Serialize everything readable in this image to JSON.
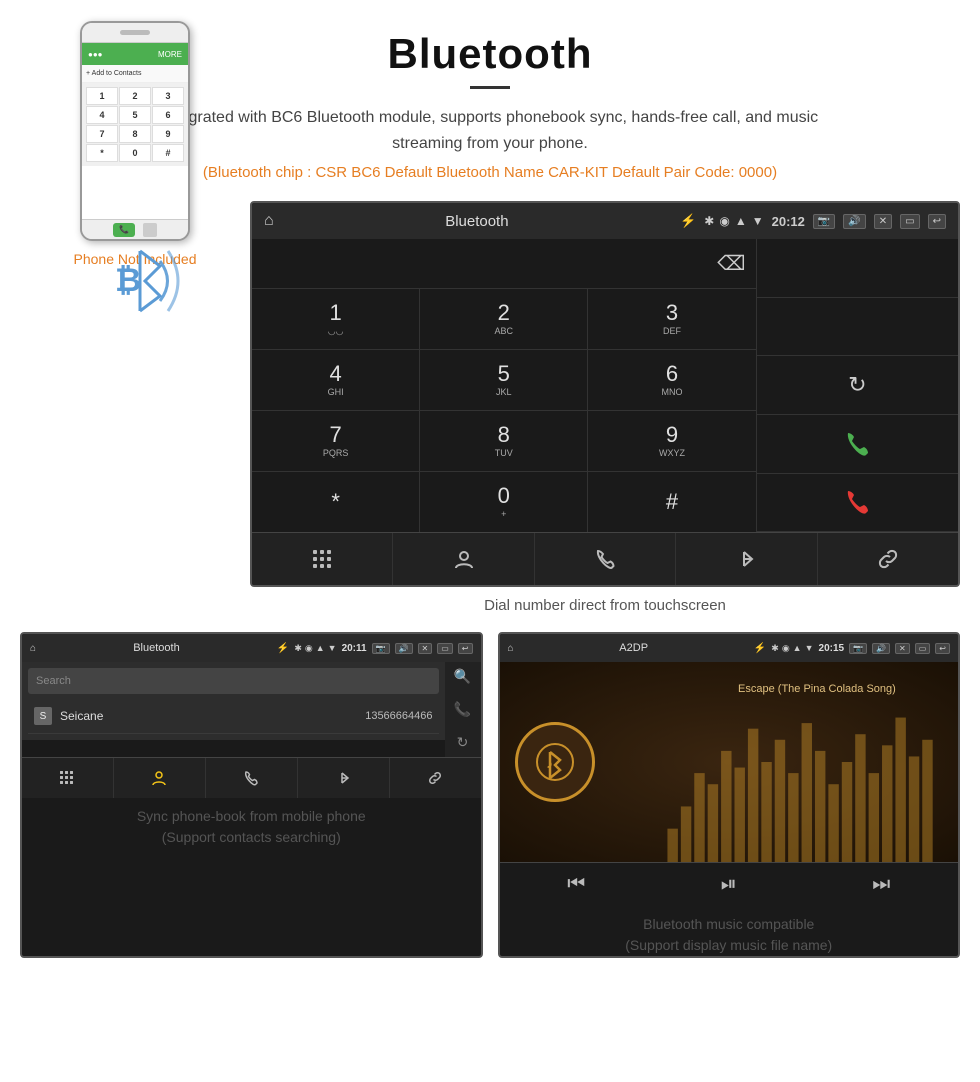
{
  "header": {
    "title": "Bluetooth",
    "divider": true,
    "description": "Integrated with BC6 Bluetooth module, supports phonebook sync, hands-free call, and music streaming from your phone.",
    "specs": "(Bluetooth chip : CSR BC6    Default Bluetooth Name CAR-KIT    Default Pair Code: 0000)"
  },
  "car_screen": {
    "status_bar": {
      "title": "Bluetooth",
      "time": "20:12",
      "usb_icon": "↯"
    },
    "display_area": {
      "backspace": "⌫"
    },
    "keys": [
      {
        "num": "1",
        "alpha": "◡◡"
      },
      {
        "num": "2",
        "alpha": "ABC"
      },
      {
        "num": "3",
        "alpha": "DEF"
      },
      {
        "num": "4",
        "alpha": "GHI"
      },
      {
        "num": "5",
        "alpha": "JKL"
      },
      {
        "num": "6",
        "alpha": "MNO"
      },
      {
        "num": "7",
        "alpha": "PQRS"
      },
      {
        "num": "8",
        "alpha": "TUV"
      },
      {
        "num": "9",
        "alpha": "WXYZ"
      },
      {
        "num": "*",
        "alpha": ""
      },
      {
        "num": "0",
        "alpha": "+"
      },
      {
        "num": "#",
        "alpha": ""
      }
    ],
    "caption": "Dial number direct from touchscreen",
    "bottom_nav_items": [
      "⊞",
      "👤",
      "📞",
      "✱",
      "🔗"
    ]
  },
  "phone_illustration": {
    "not_included_label": "Phone Not Included"
  },
  "contacts_panel": {
    "status_bar": {
      "title": "Bluetooth",
      "time": "20:11"
    },
    "search_placeholder": "Search",
    "contacts": [
      {
        "letter": "S",
        "name": "Seicane",
        "number": "13566664466"
      }
    ],
    "side_icons": [
      "🔍",
      "📞",
      "🔄"
    ],
    "bottom_nav": [
      "⊞",
      "👤",
      "📞",
      "✱",
      "🔗"
    ],
    "caption": "Sync phone-book from mobile phone\n(Support contacts searching)"
  },
  "music_panel": {
    "status_bar": {
      "title": "A2DP",
      "time": "20:15"
    },
    "track_name": "Escape (The Pina Colada Song)",
    "controls": {
      "prev": "⏮",
      "play_pause": "⏯",
      "next": "⏭"
    },
    "caption": "Bluetooth music compatible\n(Support display music file name)",
    "eq_bars": [
      30,
      50,
      40,
      70,
      60,
      45,
      80,
      55,
      65,
      50,
      75,
      60,
      40,
      55,
      70,
      45,
      60,
      80,
      50,
      65
    ]
  }
}
